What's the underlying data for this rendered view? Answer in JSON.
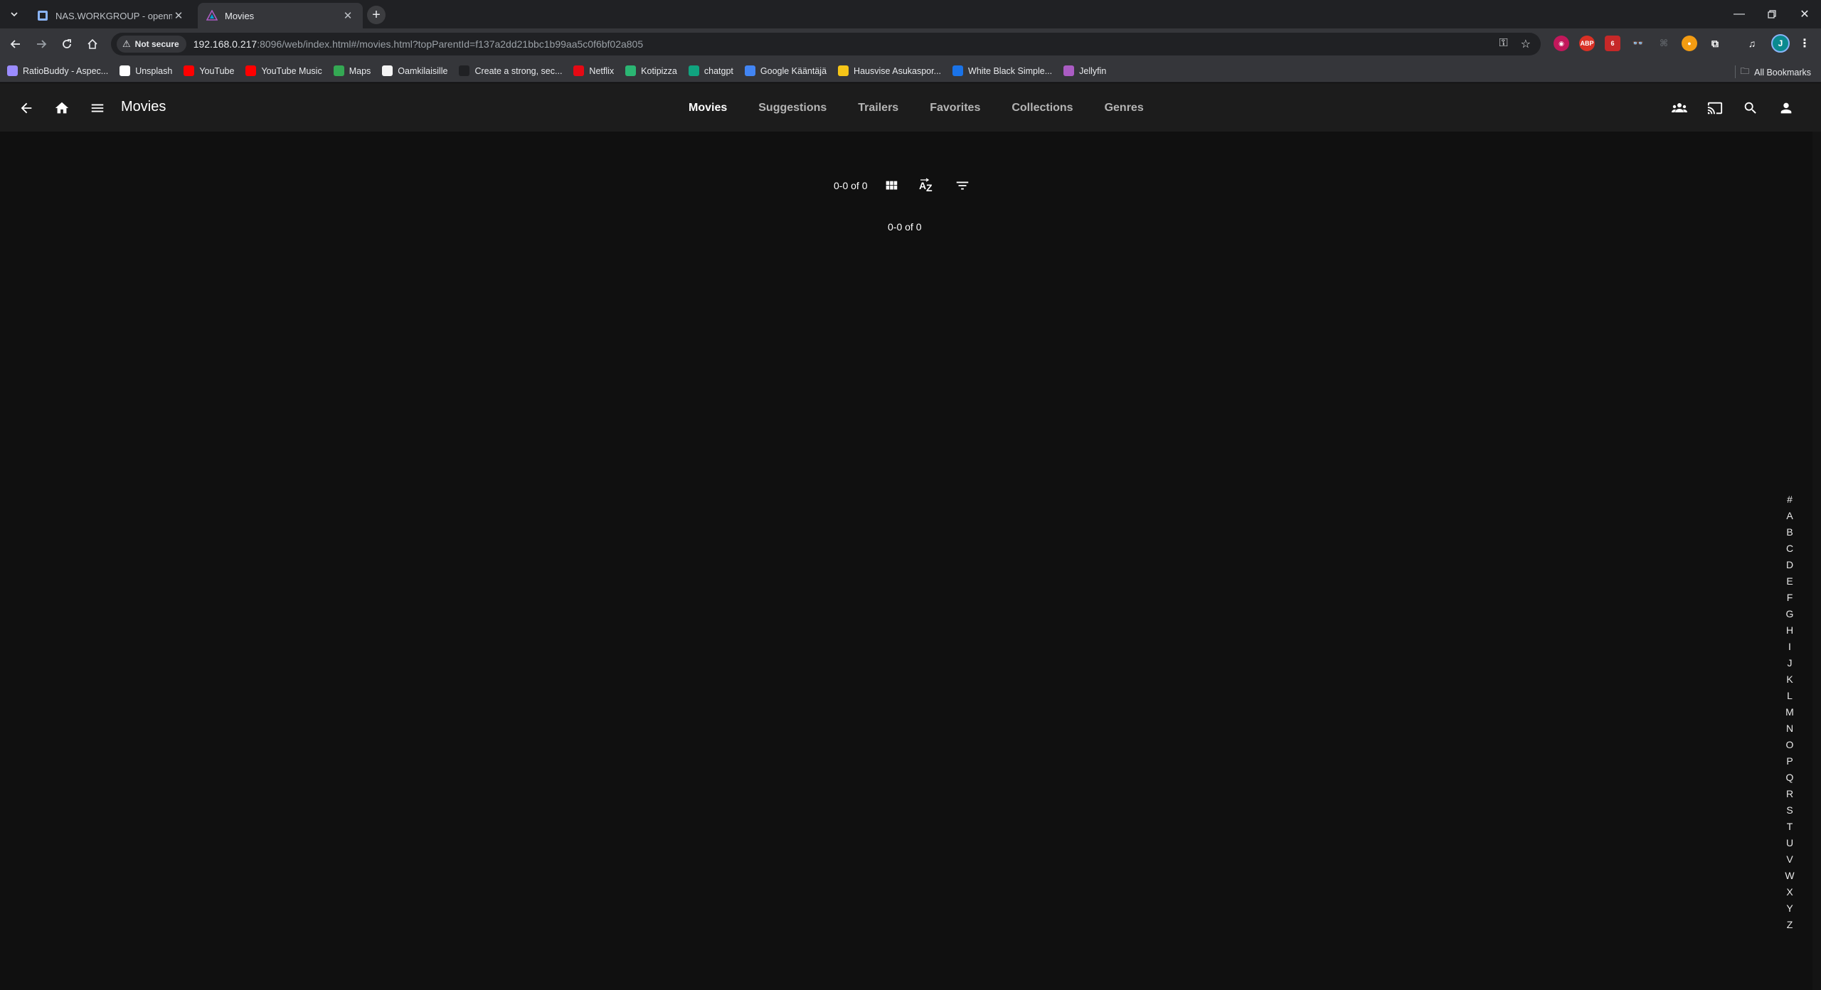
{
  "browser": {
    "tabs": [
      {
        "title": "NAS.WORKGROUP - openmedi...",
        "active": false
      },
      {
        "title": "Movies",
        "active": true
      }
    ],
    "security_chip": "Not secure",
    "url_host": "192.168.0.217",
    "url_rest": ":8096/web/index.html#/movies.html?topParentId=f137a2dd21bbc1b99aa5c0f6bf02a805",
    "profile_initial": "J",
    "extension_badge": "6",
    "bookmarks": [
      {
        "label": "RatioBuddy - Aspec...",
        "color": "#9b8cff"
      },
      {
        "label": "Unsplash",
        "color": "#ffffff"
      },
      {
        "label": "YouTube",
        "color": "#ff0000"
      },
      {
        "label": "YouTube Music",
        "color": "#ff0000"
      },
      {
        "label": "Maps",
        "color": "#34a853"
      },
      {
        "label": "Oamkilaisille",
        "color": "#f4f4f4"
      },
      {
        "label": "Create a strong, sec...",
        "color": "#202124"
      },
      {
        "label": "Netflix",
        "color": "#e50914"
      },
      {
        "label": "Kotipizza",
        "color": "#2bb673"
      },
      {
        "label": "chatgpt",
        "color": "#10a37f"
      },
      {
        "label": "Google Kääntäjä",
        "color": "#4285f4"
      },
      {
        "label": "Hausvise Asukaspor...",
        "color": "#f5c518"
      },
      {
        "label": "White Black Simple...",
        "color": "#1a73e8"
      },
      {
        "label": "Jellyfin",
        "color": "#aa5cc3"
      }
    ],
    "all_bookmarks": "All Bookmarks"
  },
  "app": {
    "page_title": "Movies",
    "tabs": [
      "Movies",
      "Suggestions",
      "Trailers",
      "Favorites",
      "Collections",
      "Genres"
    ],
    "selected_tab": "Movies",
    "pager_top": "0-0 of 0",
    "pager_bottom": "0-0 of 0",
    "alphabet": [
      "#",
      "A",
      "B",
      "C",
      "D",
      "E",
      "F",
      "G",
      "H",
      "I",
      "J",
      "K",
      "L",
      "M",
      "N",
      "O",
      "P",
      "Q",
      "R",
      "S",
      "T",
      "U",
      "V",
      "W",
      "X",
      "Y",
      "Z"
    ]
  }
}
